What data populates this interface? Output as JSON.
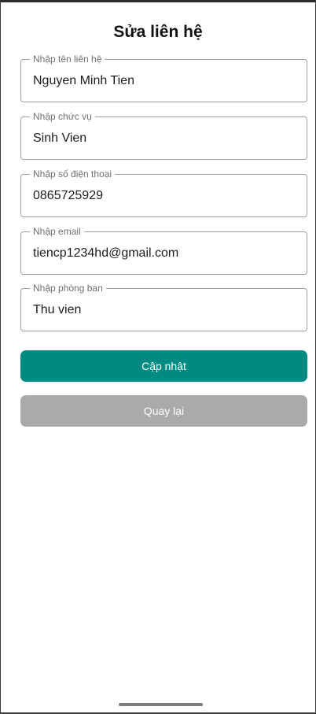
{
  "header": {
    "title": "Sửa liên hệ"
  },
  "form": {
    "fields": [
      {
        "label": "Nhập tên liên hệ",
        "value": "Nguyen Minh Tien"
      },
      {
        "label": "Nhập chức vụ",
        "value": "Sinh Vien"
      },
      {
        "label": "Nhập số điện thoại",
        "value": "0865725929"
      },
      {
        "label": "Nhập email",
        "value": "tiencp1234hd@gmail.com"
      },
      {
        "label": "Nhập phòng ban",
        "value": "Thu vien"
      }
    ]
  },
  "actions": {
    "update_label": "Cập nhật",
    "back_label": "Quay lại"
  },
  "colors": {
    "primary": "#008b82",
    "secondary": "#aaaaaa",
    "outline": "#9e9e9e",
    "label": "#6f6f6f"
  }
}
